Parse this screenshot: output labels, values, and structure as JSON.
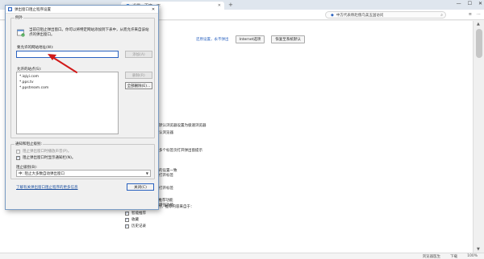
{
  "browser": {
    "tab_title": "设置 - 百度一下",
    "new_tab": "+",
    "address": "中方代表称赴俄乌美五国访问",
    "window_controls": {
      "minimize": "—",
      "maximize": "☐",
      "close": "✕"
    }
  },
  "settings_page": {
    "top_buttons": {
      "link": "还原设置，永不弹出",
      "internet_options": "Internet选项",
      "restore_default": "恢复至系统默认"
    },
    "lines": [
      "默认浏览器设置为极速浏览器",
      "认浏览器",
      "多个标签页打开弹出窗提示",
      "的设置一致",
      "打开标签",
      "打开标签",
      "增强功能"
    ],
    "dynamic_label": "动态智能地址栏",
    "dynamic_options": [
      {
        "label": "开启动态智能地址栏推荐功能",
        "checked": true
      },
      {
        "label": "启用动态智能地址栏时，推荐内容来自于：",
        "checked": null
      },
      {
        "label": "智能推荐",
        "checked": true
      },
      {
        "label": "收藏",
        "checked": true
      },
      {
        "label": "历史记录",
        "checked": true
      }
    ]
  },
  "status_bar": {
    "items": [
      "浏览器医生",
      "下载",
      "100%"
    ]
  },
  "dialog": {
    "title": "弹出窗口阻止程序设置",
    "close_symbol": "✕",
    "exceptions_group_label": "例外",
    "info_text": "当前已阻止弹出窗口。你可以将特定网站添加到下表中，从而允许来自该站点的弹出窗口。",
    "address_label": "要允许的网站地址(W):",
    "address_value": "",
    "add_button": "添加(A)",
    "allowed_label": "允许的站点(S):",
    "allowed_sites": [
      "*.iqiyi.com",
      "*.pps.tv",
      "*.ppstream.com"
    ],
    "remove_button": "删除(R)",
    "remove_all_button": "全部删除(E)...",
    "notify_group_label": "通知和阻止级别:",
    "notify_options": [
      {
        "label": "阻止弹出窗口时播放声音(P)。",
        "checked": true,
        "disabled": true
      },
      {
        "label": "阻止弹出窗口时显示通知栏(N)。",
        "checked": true,
        "disabled": false
      }
    ],
    "block_level_label": "阻止级别(B):",
    "block_level_value": "中: 阻止大多数自动弹出窗口",
    "learn_more_link": "了解有关弹出窗口阻止程序的更多信息",
    "close_button": "关闭(C)"
  },
  "ie_buttons": {
    "ok": "确定",
    "cancel": "取消",
    "apply": "应用(A)"
  },
  "colors": {
    "accent": "#2a62c0",
    "arrow": "#d11a1a"
  }
}
